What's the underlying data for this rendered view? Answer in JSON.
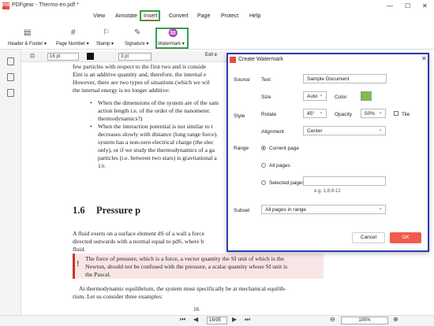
{
  "app": {
    "logo": "PDF",
    "title": "PDFgear - Thermo-en.pdf *"
  },
  "menu": {
    "items": [
      "View",
      "Annotate",
      "Insert",
      "Convert",
      "Page",
      "Protect",
      "Help"
    ]
  },
  "window_controls": {
    "minimize": "—",
    "maximize": "☐",
    "close": "✕"
  },
  "ribbon": {
    "header_footer": "Header & Footer ▾",
    "page_number": "Page Number ▾",
    "stamp": "Stamp ▾",
    "signature": "Signature ▾",
    "watermark": "Watermark ▾"
  },
  "edit_toolbar": {
    "font_size": "16 pt",
    "line_width": "3 pt",
    "exit": "Exit e"
  },
  "document": {
    "lines": [
      "few particles with respect to the first two and is conside",
      "Eint is an additive quantity and, therefore, the internal e",
      "However, there are two types of situations (which we wil",
      "the internal energy is no longer additive:"
    ],
    "bullet1": [
      "When the dimensions of the system are of the sam",
      "action length i.e. of the order of the nanometer.",
      "thermodynamics?)"
    ],
    "bullet2": [
      "When the interaction potential is not similar to t",
      "decreases slowly with distance (long range force).",
      "system has a non-zero electrical charge (the elec",
      "only), or if we study the thermodynamics of a ga",
      "particles (i.e. between two stars) is gravitational a",
      "1/r."
    ],
    "section_num": "1.6",
    "section_title": "Pressure p",
    "para1": [
      "A fluid exerts on a surface element dS of a wall a force",
      "directed outwards with a normal equal to pdS, where b",
      "fluid."
    ],
    "note": [
      "The force of pressure, which is a force, a vector quantity the SI unit of which is the",
      "Newton, should not be confused with the pressure, a scalar quantity whose SI unit is",
      "the Pascal."
    ],
    "para2": [
      "At thermodynamic equilibrium, the system must specifically be at mechanical equilib-",
      "rium. Let us consider three examples:"
    ],
    "page_number": "16"
  },
  "bottom_nav": {
    "page": "16/95",
    "zoom": "100%"
  },
  "dialog": {
    "title": "Create Watermark",
    "close": "✕",
    "source_label": "Source",
    "text_label": "Text",
    "text_value": "Sample Document",
    "size_label": "Size",
    "size_value": "Auto",
    "color_label": "Color",
    "color_value": "#7ac143",
    "style_label": "Style",
    "rotate_label": "Rotate",
    "rotate_value": "45°",
    "opacity_label": "Opacity",
    "opacity_value": "50%",
    "tile_label": "Tile",
    "alignment_label": "Alignment",
    "alignment_value": "Center",
    "range_label": "Range",
    "current_page": "Current page",
    "all_pages": "All pages",
    "selected_pages": "Selected pages",
    "selected_hint": "e.g. 1,8,9-12",
    "subset_label": "Subset",
    "subset_value": "All pages in range",
    "cancel": "Cancel",
    "ok": "OK"
  }
}
